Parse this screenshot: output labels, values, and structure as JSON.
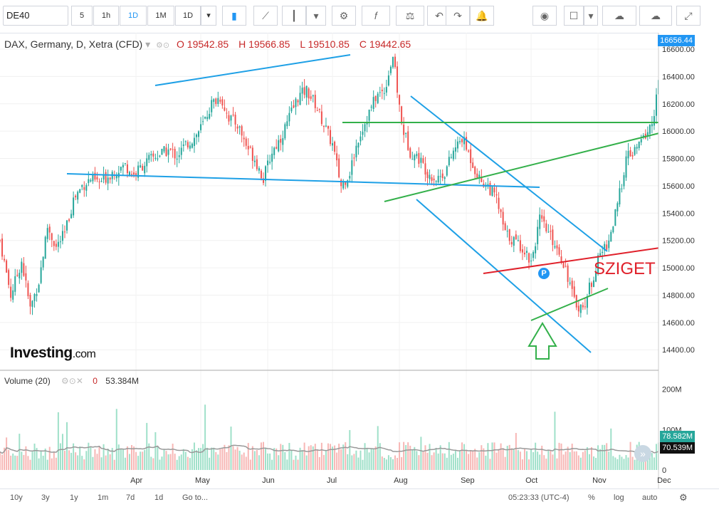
{
  "toolbar": {
    "symbol": "DE40",
    "intervals": [
      "5",
      "1h",
      "1D",
      "1M",
      "1D"
    ],
    "active_interval": "1D"
  },
  "legend": {
    "title": "DAX, Germany, D, Xetra (CFD)",
    "open": "O 19542.85",
    "high": "H 19566.85",
    "low": "L 19510.85",
    "close": "C 19442.65"
  },
  "volume_legend": {
    "title": "Volume (20)",
    "zero": "0",
    "value": "53.384M"
  },
  "logo": {
    "main": "Investing",
    "suffix": ".com"
  },
  "annotation": {
    "text": "SZIGET",
    "marker": "P"
  },
  "bottombar": {
    "ranges": [
      "10y",
      "3y",
      "1y",
      "1m",
      "7d",
      "1d",
      "Go to..."
    ],
    "time": "05:23:33 (UTC-4)",
    "percent": "%",
    "log": "log",
    "auto": "auto"
  },
  "colors": {
    "up": "#26a69a",
    "down": "#ef5350",
    "trend_blue": "#1ea0e6",
    "trend_green": "#33b04a",
    "trend_red": "#e0202a"
  },
  "chart_data": {
    "type": "candlestick",
    "price_axis": {
      "ticks": [
        14400,
        14600,
        14800,
        15000,
        15200,
        15400,
        15600,
        15800,
        16000,
        16200,
        16400,
        16600
      ],
      "range": [
        14250,
        16720
      ],
      "last_price_label": "16656.44"
    },
    "x_axis": {
      "ticks": [
        "Apr",
        "May",
        "Jun",
        "Jul",
        "Aug",
        "Sep",
        "Oct",
        "Nov",
        "Dec"
      ]
    },
    "volume_axis": {
      "ticks": [
        "200M",
        "100M",
        "0"
      ],
      "range": [
        0,
        240
      ],
      "badges": [
        "78.582M",
        "70.539M"
      ]
    },
    "x_range_days": [
      -60,
      245
    ],
    "x_day_of_month_starts": {
      "Apr": 0,
      "May": 30,
      "Jun": 61,
      "Jul": 91,
      "Aug": 122,
      "Sep": 153,
      "Oct": 183,
      "Nov": 214,
      "Dec": 244
    },
    "close_path": [
      [
        -60,
        15200
      ],
      [
        -55,
        14800
      ],
      [
        -50,
        15050
      ],
      [
        -46,
        14700
      ],
      [
        -42,
        14900
      ],
      [
        -38,
        15300
      ],
      [
        -34,
        15150
      ],
      [
        -30,
        15250
      ],
      [
        -26,
        15500
      ],
      [
        -22,
        15600
      ],
      [
        -18,
        15650
      ],
      [
        -14,
        15620
      ],
      [
        -8,
        15700
      ],
      [
        -2,
        15750
      ],
      [
        2,
        15680
      ],
      [
        6,
        15750
      ],
      [
        10,
        15800
      ],
      [
        14,
        15830
      ],
      [
        18,
        15860
      ],
      [
        22,
        15820
      ],
      [
        26,
        15900
      ],
      [
        30,
        15950
      ],
      [
        34,
        16050
      ],
      [
        38,
        16200
      ],
      [
        42,
        16250
      ],
      [
        46,
        16100
      ],
      [
        50,
        16050
      ],
      [
        54,
        15900
      ],
      [
        58,
        15800
      ],
      [
        62,
        15650
      ],
      [
        66,
        15850
      ],
      [
        70,
        15950
      ],
      [
        74,
        16100
      ],
      [
        78,
        16250
      ],
      [
        82,
        16300
      ],
      [
        86,
        16200
      ],
      [
        90,
        16050
      ],
      [
        94,
        15900
      ],
      [
        98,
        15600
      ],
      [
        102,
        15700
      ],
      [
        106,
        15950
      ],
      [
        110,
        16100
      ],
      [
        114,
        16250
      ],
      [
        118,
        16300
      ],
      [
        122,
        16550
      ],
      [
        126,
        16050
      ],
      [
        130,
        15850
      ],
      [
        134,
        15800
      ],
      [
        138,
        15700
      ],
      [
        142,
        15650
      ],
      [
        146,
        15700
      ],
      [
        150,
        15850
      ],
      [
        154,
        15950
      ],
      [
        158,
        15800
      ],
      [
        162,
        15650
      ],
      [
        166,
        15600
      ],
      [
        170,
        15500
      ],
      [
        174,
        15250
      ],
      [
        178,
        15200
      ],
      [
        182,
        15150
      ],
      [
        186,
        15050
      ],
      [
        190,
        15350
      ],
      [
        194,
        15250
      ],
      [
        198,
        15150
      ],
      [
        202,
        15000
      ],
      [
        206,
        14750
      ],
      [
        210,
        14700
      ],
      [
        214,
        14900
      ],
      [
        218,
        15100
      ],
      [
        222,
        15200
      ],
      [
        226,
        15450
      ],
      [
        230,
        15800
      ],
      [
        234,
        15850
      ],
      [
        238,
        15950
      ],
      [
        242,
        16050
      ],
      [
        244,
        16250
      ],
      [
        246,
        16450
      ],
      [
        248,
        16656
      ]
    ],
    "volume_series": {
      "type": "bar",
      "approx_range_M": [
        10,
        210
      ]
    }
  }
}
